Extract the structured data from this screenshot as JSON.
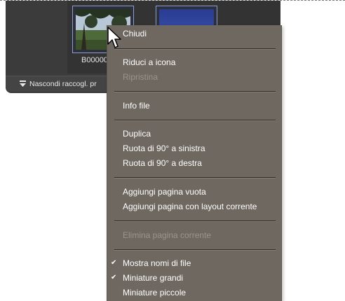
{
  "bin": {
    "thumbnail_1_label": "B00000",
    "hide_bin_label": "Nascondi raccogl. pr"
  },
  "menu": {
    "items": [
      {
        "label": "Chiudi",
        "enabled": true
      },
      {
        "label": "Riduci a icona",
        "enabled": true
      },
      {
        "label": "Ripristina",
        "enabled": false
      },
      {
        "label": "Info file",
        "enabled": true
      },
      {
        "label": "Duplica",
        "enabled": true
      },
      {
        "label": "Ruota di 90° a sinistra",
        "enabled": true
      },
      {
        "label": "Ruota di 90° a destra",
        "enabled": true
      },
      {
        "label": "Aggiungi pagina vuota",
        "enabled": true
      },
      {
        "label": "Aggiungi pagina con layout corrente",
        "enabled": true
      },
      {
        "label": "Elimina pagina corrente",
        "enabled": false
      },
      {
        "label": "Mostra nomi di file",
        "enabled": true,
        "checked": true
      },
      {
        "label": "Miniature grandi",
        "enabled": true,
        "checked": true
      },
      {
        "label": "Miniature piccole",
        "enabled": true,
        "checked": false
      }
    ],
    "check_glyph": "✔"
  },
  "icons": {
    "cursor": "arrow-cursor-icon",
    "hide_bin": "arrow-down-bar-icon",
    "check": "checkmark-icon"
  },
  "colors": {
    "menu_bg": "#6e6860",
    "menu_text": "#ffffff",
    "menu_disabled_text": "#9a948c",
    "panel_bg": "#3b3b3b",
    "thumbnail_border": "#8aa0d0"
  }
}
